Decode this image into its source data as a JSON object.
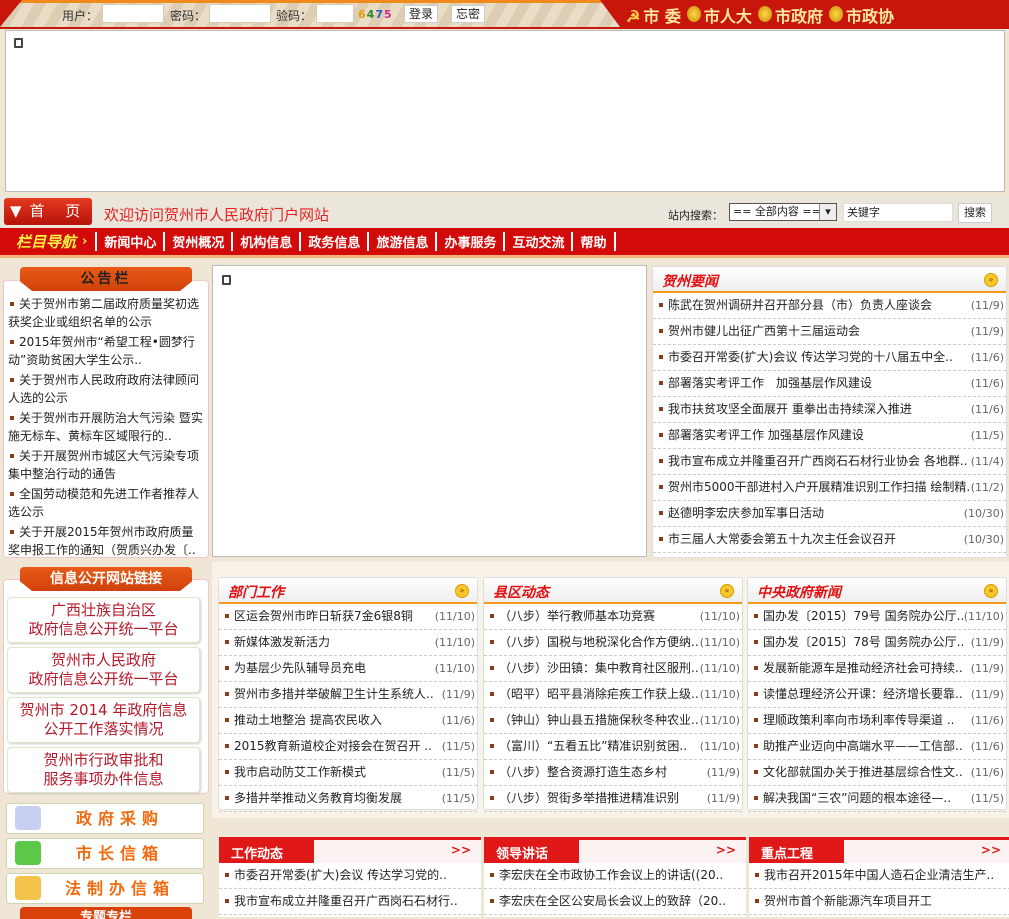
{
  "login": {
    "user_label": "用户：",
    "pass_label": "密码：",
    "captcha_label": "验码：",
    "captcha": [
      "6",
      "4",
      "7",
      "5"
    ],
    "login_button": "登录",
    "forgot_button": "忘密"
  },
  "orgs": [
    "市 委",
    "市人大",
    "市政府",
    "市政协"
  ],
  "header": {
    "home": "▼首 页",
    "welcome": "欢迎访问贺州市人民政府门户网站",
    "search_label": "站内搜索：",
    "search_scope": "== 全部内容 ==",
    "search_placeholder": "关键字",
    "search_button": "搜索"
  },
  "nav": {
    "title": "栏目导航",
    "items": [
      "新闻中心",
      "贺州概况",
      "机构信息",
      "政务信息",
      "旅游信息",
      "办事服务",
      "互动交流",
      "帮助"
    ]
  },
  "notice": {
    "title": "公告栏",
    "items": [
      "关于贺州市第二届政府质量奖初选获奖企业或组织名单的公示",
      "2015年贺州市“希望工程•圆梦行动”资助贫困大学生公示..",
      "关于贺州市人民政府政府法律顾问人选的公示",
      "关于贺州市开展防治大气污染 暨实施无标车、黄标车区域限行的..",
      "关于开展贺州市城区大气污染专项集中整治行动的通告",
      "全国劳动模范和先进工作者推荐人选公示",
      "关于开展2015年贺州市政府质量奖申报工作的通知（贺质兴办发〔.."
    ]
  },
  "hezhou_news": {
    "title": "贺州要闻",
    "items": [
      [
        "陈武在贺州调研并召开部分县（市）负责人座谈会",
        "(11/9)"
      ],
      [
        "贺州市健儿出征广西第十三届运动会",
        "(11/9)"
      ],
      [
        "市委召开常委(扩大)会议 传达学习党的十八届五中全..",
        "(11/6)"
      ],
      [
        "部署落实考评工作　加强基层作风建设",
        "(11/6)"
      ],
      [
        "我市扶贫攻坚全面展开 重拳出击持续深入推进",
        "(11/6)"
      ],
      [
        "部署落实考评工作 加强基层作风建设",
        "(11/5)"
      ],
      [
        "我市宣布成立并隆重召开广西岗石石材行业协会 各地群..",
        "(11/4)"
      ],
      [
        "贺州市5000干部进村入户开展精准识别工作扫描 绘制精..",
        "(11/2)"
      ],
      [
        "赵德明李宏庆参加军事日活动",
        "(10/30)"
      ],
      [
        "市三届人大常委会第五十九次主任会议召开",
        "(10/30)"
      ]
    ]
  },
  "links": {
    "title": "信息公开网站链接",
    "items": [
      [
        "广西壮族自治区",
        "政府信息公开统一平台"
      ],
      [
        "贺州市人民政府",
        "政府信息公开统一平台"
      ],
      [
        "贺州市 2014 年政府信息",
        "公开工作落实情况"
      ],
      [
        "贺州市行政审批和",
        "服务事项办件信息"
      ]
    ],
    "buttons": [
      "政府采购",
      "市长信箱",
      "法制办信箱"
    ],
    "next_title": "专题专栏"
  },
  "dept": {
    "title": "部门工作",
    "items": [
      [
        "区运会贺州市昨日斩获7金6银8铜",
        "(11/10)"
      ],
      [
        "新媒体激发新活力",
        "(11/10)"
      ],
      [
        "为基层少先队辅导员充电",
        "(11/10)"
      ],
      [
        "贺州市多措并举破解卫生计生系统人..",
        "(11/9)"
      ],
      [
        "推动土地整治 提高农民收入",
        "(11/6)"
      ],
      [
        "2015教育新道校企对接会在贺召开 ..",
        "(11/5)"
      ],
      [
        "我市启动防艾工作新模式",
        "(11/5)"
      ],
      [
        "多措并举推动义务教育均衡发展",
        "(11/5)"
      ]
    ]
  },
  "county": {
    "title": "县区动态",
    "items": [
      [
        "（八步）举行教师基本功竞赛",
        "(11/10)"
      ],
      [
        "（八步）国税与地税深化合作方便纳..",
        "(11/10)"
      ],
      [
        "（八步）沙田镇：集中教育社区服刑..",
        "(11/10)"
      ],
      [
        "（昭平）昭平县消除疟疾工作获上级..",
        "(11/10)"
      ],
      [
        "（钟山）钟山县五措施保秋冬种农业..",
        "(11/10)"
      ],
      [
        "（富川）“五看五比”精准识别贫困..",
        "(11/10)"
      ],
      [
        "（八步）整合资源打造生态乡村",
        "(11/9)"
      ],
      [
        "（八步）贺街多举措推进精准识别",
        "(11/9)"
      ]
    ]
  },
  "central": {
    "title": "中央政府新闻",
    "items": [
      [
        "国办发〔2015〕79号 国务院办公厅..",
        "(11/10)"
      ],
      [
        "国办发〔2015〕78号 国务院办公厅..",
        "(11/9)"
      ],
      [
        "发展新能源车是推动经济社会可持续..",
        "(11/9)"
      ],
      [
        "读懂总理经济公开课：经济增长要靠..",
        "(11/9)"
      ],
      [
        "理顺政策利率向市场利率传导渠道 ..",
        "(11/6)"
      ],
      [
        "助推产业迈向中高端水平——工信部..",
        "(11/6)"
      ],
      [
        "文化部就国办关于推进基层综合性文..",
        "(11/6)"
      ],
      [
        "解决我国“三农”问题的根本途径—..",
        "(11/5)"
      ]
    ]
  },
  "bottom": [
    {
      "title": "工作动态",
      "more": ">>",
      "items": [
        "市委召开常委(扩大)会议 传达学习党的..",
        "我市宣布成立并隆重召开广西岗石石材行.."
      ]
    },
    {
      "title": "领导讲话",
      "more": ">>",
      "items": [
        "李宏庆在全市政协工作会议上的讲话((20..",
        "李宏庆在全区公安局长会议上的致辞（20.."
      ]
    },
    {
      "title": "重点工程",
      "more": ">>",
      "items": [
        "我市召开2015年中国人造石企业清洁生产..",
        "贺州市首个新能源汽车项目开工"
      ]
    }
  ]
}
